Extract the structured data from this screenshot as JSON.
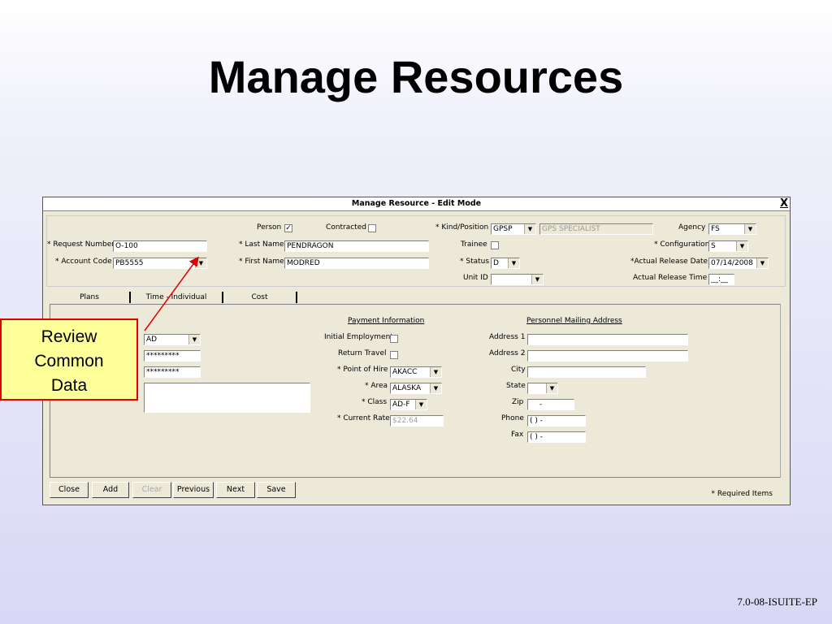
{
  "slide": {
    "title": "Manage Resources",
    "footer": "7.0-08-ISUITE-EP"
  },
  "window": {
    "title": "Manage Resource - Edit Mode",
    "close": "X"
  },
  "header": {
    "person_label": "Person",
    "person_checked": true,
    "contracted_label": "Contracted",
    "contracted_checked": false,
    "kind_position_label": "* Kind/Position",
    "kind_position_value": "GPSP",
    "kind_position_desc": "GPS SPECIALIST",
    "agency_label": "Agency",
    "agency_value": "FS",
    "request_number_label": "* Request Number",
    "request_number_value": "O-100",
    "last_name_label": "* Last Name",
    "last_name_value": "PENDRAGON",
    "trainee_label": "Trainee",
    "trainee_checked": false,
    "configuration_label": "* Configuration",
    "configuration_value": "S",
    "account_code_label": "* Account Code",
    "account_code_value": "PB5555",
    "first_name_label": "* First Name",
    "first_name_value": "MODRED",
    "status_label": "* Status",
    "status_value": "D",
    "actual_release_date_label": "*Actual Release Date",
    "actual_release_date_value": "07/14/2008",
    "unit_id_label": "Unit ID",
    "unit_id_value": "",
    "actual_release_time_label": "Actual Release Time",
    "actual_release_time_value": "__:__"
  },
  "tabs": [
    {
      "label": "Plans"
    },
    {
      "label": "Time - Individual"
    },
    {
      "label": "Cost"
    }
  ],
  "time_tab": {
    "left_dropdown_value": "AD",
    "masked_field_1": "*********",
    "masked_field_2": "*********",
    "payment_header": "Payment Information",
    "initial_employment_label": "Initial Employment",
    "return_travel_label": "Return Travel",
    "point_of_hire_label": "* Point of Hire",
    "point_of_hire_value": "AKACC",
    "area_label": "* Area",
    "area_value": "ALASKA",
    "class_label": "* Class",
    "class_value": "AD-F",
    "current_rate_label": "* Current Rate",
    "current_rate_value": "$22.64",
    "mailing_header": "Personnel Mailing Address",
    "address1_label": "Address 1",
    "address2_label": "Address 2",
    "city_label": "City",
    "state_label": "State",
    "zip_label": "Zip",
    "zip_value": "-",
    "phone_label": "Phone",
    "phone_value": "(   )   -",
    "fax_label": "Fax",
    "fax_value": "(   )   -"
  },
  "buttons": {
    "close": "Close",
    "add": "Add",
    "clear": "Clear",
    "previous": "Previous",
    "next": "Next",
    "save": "Save",
    "required_note": "* Required Items"
  },
  "callout": {
    "line1": "Review",
    "line2": "Common",
    "line3": "Data",
    "border_color": "#e00000",
    "fill_color": "#ffff99"
  },
  "icons": {
    "dropdown": "chevron-down-icon",
    "checkbox": "checkbox-icon",
    "close": "close-icon"
  }
}
